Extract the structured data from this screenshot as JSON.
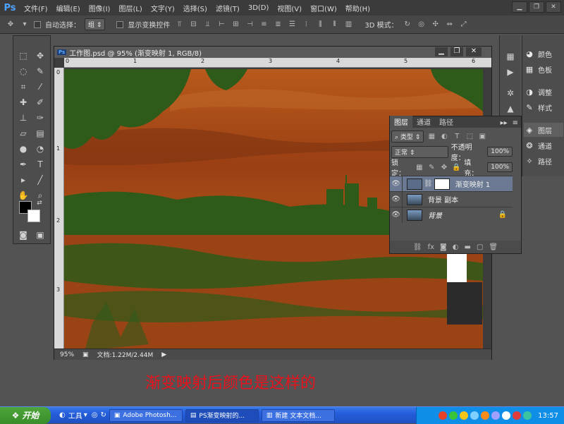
{
  "app": {
    "logo": "Ps"
  },
  "menu": [
    "文件(F)",
    "编辑(E)",
    "图像(I)",
    "图层(L)",
    "文字(Y)",
    "选择(S)",
    "滤镜(T)",
    "3D(D)",
    "视图(V)",
    "窗口(W)",
    "帮助(H)"
  ],
  "options": {
    "auto_select": "自动选择：",
    "group_value": "组",
    "show_transform": "显示变换控件",
    "mode3d": "3D 模式："
  },
  "document": {
    "title": "工作图.psd @ 95% (渐变映射 1, RGB/8)",
    "ruler_top": [
      "0",
      "1",
      "2",
      "3",
      "4",
      "5",
      "6"
    ],
    "ruler_left": [
      "0",
      "1",
      "2",
      "3"
    ],
    "zoom": "95%",
    "docinfo": "文档:1.22M/2.44M"
  },
  "right_strip": {
    "color": "颜色",
    "swatches": "色板",
    "adjust": "调整",
    "styles": "样式",
    "layers": "图层",
    "channels": "通道",
    "paths": "路径"
  },
  "layers_panel": {
    "tabs": [
      "图层",
      "通道",
      "路径"
    ],
    "kind": "类型",
    "blend_mode": "正常",
    "opacity_label": "不透明度：",
    "opacity": "100%",
    "lock_label": "锁定：",
    "fill_label": "填充：",
    "fill": "100%",
    "layers": [
      {
        "name": "渐变映射 1"
      },
      {
        "name": "背景 副本"
      },
      {
        "name": "背景"
      }
    ]
  },
  "caption": "渐变映射后颜色是这样的",
  "taskbar": {
    "start": "开始",
    "tools": "工具",
    "tasks": [
      "Adobe Photosh...",
      "PS渐变映射的...",
      "新建 文本文档..."
    ],
    "clock": "13:57"
  },
  "colors": {
    "accent": "#e8101b",
    "canvas": "#a94a16",
    "vegetation": "#2e5a1a"
  }
}
